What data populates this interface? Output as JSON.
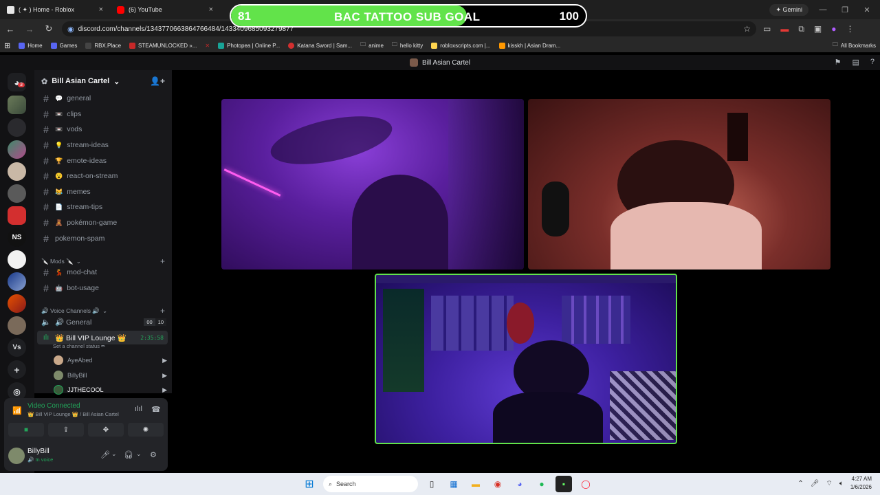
{
  "browser": {
    "tabs": [
      {
        "title": "( ✦ ) Home - Roblox",
        "close": "×"
      },
      {
        "title": "(6) YouTube",
        "close": "×"
      }
    ],
    "gemini_label": "✦ Gemini",
    "url": "discord.com/channels/1343770663864766484/1433409685093279877",
    "bookmarks": [
      "Home",
      "Games",
      "RBX.Place",
      "STEAMUNLOCKED »...",
      "Photopea | Online P...",
      "Katana Sword | Sam...",
      "anime",
      "hello kitty",
      "robloxscripts.com |...",
      "kisskh | Asian Dram..."
    ],
    "all_bookmarks": "All Bookmarks"
  },
  "overlay": {
    "current": "81",
    "title": "BAC TATTOO SUB GOAL",
    "goal": "100",
    "progress": 0.81
  },
  "discord": {
    "window_title": "Bill Asian Cartel",
    "server_name": "Bill Asian Cartel",
    "rail_badge": "3",
    "rail_text_servers": [
      "NS",
      "Vs"
    ],
    "channels": [
      {
        "emoji": "💬",
        "name": "general"
      },
      {
        "emoji": "📼",
        "name": "clips"
      },
      {
        "emoji": "📼",
        "name": "vods"
      },
      {
        "emoji": "💡",
        "name": "stream-ideas"
      },
      {
        "emoji": "🏆",
        "name": "emote-ideas"
      },
      {
        "emoji": "😮",
        "name": "react-on-stream"
      },
      {
        "emoji": "😹",
        "name": "memes"
      },
      {
        "emoji": "📄",
        "name": "stream-tips"
      },
      {
        "emoji": "🧸",
        "name": "pokémon-game"
      },
      {
        "emoji": "",
        "name": "pokemon-spam"
      }
    ],
    "mods_category": "🔪 Mods 🔪",
    "mod_channels": [
      {
        "emoji": "💃",
        "name": "mod-chat"
      },
      {
        "emoji": "🤖",
        "name": "bot-usage"
      }
    ],
    "voice_category": "🔊 Voice Channels 🔊",
    "voice_general": {
      "name": "🔊 General",
      "count_a": "00",
      "count_b": "10"
    },
    "vip_lounge": {
      "name": "👑 Bill VIP Lounge 👑",
      "timer": "2:35:58",
      "status": "Set a channel status ✏"
    },
    "members": [
      "AyeAbed",
      "BillyBill",
      "JJTHECOOL"
    ],
    "voice_panel": {
      "title": "Video Connected",
      "sub": "👑 Bill VIP Lounge 👑 / Bill Asian Cartel"
    },
    "user": {
      "name": "BillyBill",
      "status": "🔊 In voice"
    }
  },
  "taskbar": {
    "search_placeholder": "Search",
    "time": "4:27 AM",
    "date": "1/6/2026"
  }
}
